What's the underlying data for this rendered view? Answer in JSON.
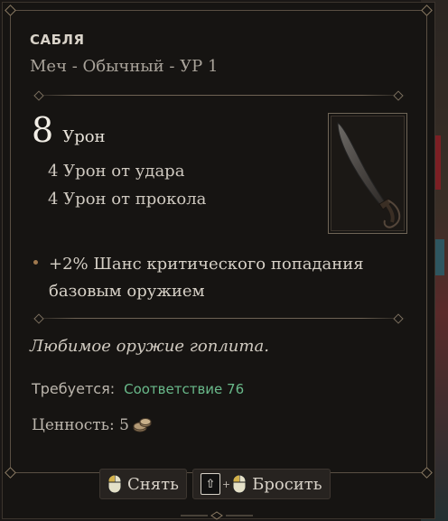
{
  "item": {
    "name": "САБЛЯ",
    "subtitle": "Меч - Обычный - УР 1",
    "image_icon": "saber-icon"
  },
  "damage": {
    "total": "8",
    "label": "Урон",
    "details": [
      "4 Урон от удара",
      "4 Урон от прокола"
    ]
  },
  "bonuses": [
    "+2% Шанс критического попадания базовым оружием"
  ],
  "flavor": "Любимое оружие гоплита.",
  "requirement": {
    "label": "Требуется:",
    "value": "Соответствие 76",
    "color": "#69b98a"
  },
  "value": {
    "label": "Ценность: 5",
    "icon": "coins-icon"
  },
  "actions": {
    "unequip": {
      "label": "Снять",
      "icon": "mouse-icon"
    },
    "drop": {
      "label": "Бросить",
      "key": "⇧",
      "plus": "+",
      "icon": "mouse-icon"
    }
  },
  "colors": {
    "background": "#161412",
    "text": "#d8d2c8",
    "accent": "#a0794e"
  }
}
